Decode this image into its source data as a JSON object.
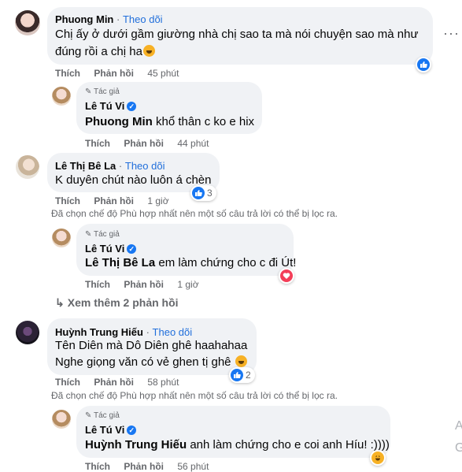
{
  "comments": [
    {
      "name": "Phuong Min",
      "follow": "Theo dõi",
      "line1": "Chị ấy ở dưới gầm giường nhà chị sao ta mà nói chuyện sao mà như",
      "line2": "đúng rồi a chị ha",
      "like": "Thích",
      "reply": "Phản hồi",
      "time": "45 phút"
    },
    {
      "author_badge": "Tác giả",
      "name": "Lê Tú Vi",
      "tag": "Phuong Min",
      "text": " khổ thân c ko e hix",
      "like": "Thích",
      "reply": "Phản hồi",
      "time": "44 phút"
    },
    {
      "name": "Lê Thị Bê La",
      "follow": "Theo dõi",
      "text": "K duyên chút nào luôn á chèn",
      "like": "Thích",
      "reply": "Phản hồi",
      "time": "1 giờ",
      "reaction_count": "3",
      "filter_note": "Đã chọn chế độ Phù hợp nhất nên một số câu trả lời có thể bị lọc ra."
    },
    {
      "author_badge": "Tác giả",
      "name": "Lê Tú Vi",
      "tag": "Lê Thị Bê La",
      "text": " em làm chứng cho c đi Út!",
      "like": "Thích",
      "reply": "Phản hồi",
      "time": "1 giờ"
    },
    {
      "see_more": "Xem thêm 2 phản hồi"
    },
    {
      "name": "Huỳnh Trung Hiếu",
      "follow": "Theo dõi",
      "line1": "Tên Diên mà Dô Diên ghê haahahaa",
      "line2": "Nghe giọng văn có vẻ ghen tị ghê",
      "like": "Thích",
      "reply": "Phản hồi",
      "time": "58 phút",
      "reaction_count": "2",
      "filter_note": "Đã chọn chế độ Phù hợp nhất nên một số câu trả lời có thể bị lọc ra."
    },
    {
      "author_badge": "Tác giả",
      "name": "Lê Tú Vi",
      "tag": "Huỳnh Trung Hiếu",
      "text": " anh làm chứng cho e coi anh Híu! :))))",
      "like": "Thích",
      "reply": "Phản hồi",
      "time": "56 phút"
    }
  ],
  "dot_separator": "·",
  "colors": {
    "link": "#216fdb",
    "muted": "#65676b",
    "bubble": "#f0f2f5",
    "like": "#1877f2",
    "love": "#f33e58",
    "haha": "#f7b125"
  },
  "icons": [
    "more-options-icon",
    "like-reaction-icon",
    "love-reaction-icon",
    "haha-reaction-icon",
    "verified-icon",
    "pencil-icon",
    "reply-arrow-icon"
  ]
}
